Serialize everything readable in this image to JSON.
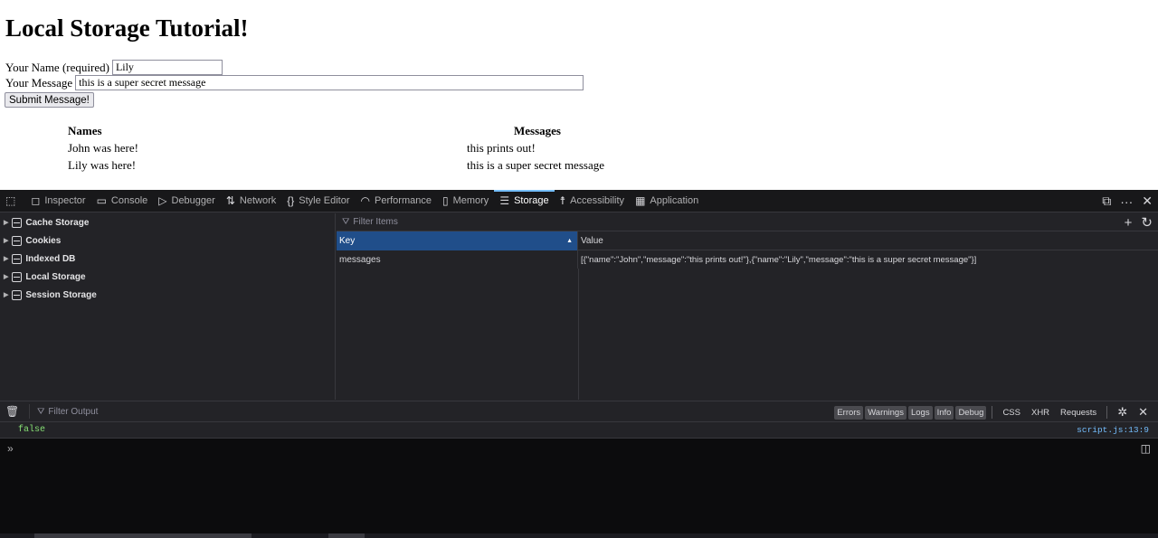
{
  "page": {
    "title": "Local Storage Tutorial!",
    "name_label": "Your Name (required)",
    "name_value": "Lily",
    "message_label": "Your Message",
    "message_value": "this is a super secret message",
    "submit_label": "Submit Message!",
    "table": {
      "headers": [
        "Names",
        "Messages"
      ],
      "rows": [
        {
          "name": "John was here!",
          "message": "this prints out!"
        },
        {
          "name": "Lily was here!",
          "message": "this is a super secret message"
        }
      ]
    }
  },
  "devtools": {
    "tabs": [
      {
        "label": "Inspector",
        "icon": "inspector-icon"
      },
      {
        "label": "Console",
        "icon": "console-icon"
      },
      {
        "label": "Debugger",
        "icon": "debugger-icon"
      },
      {
        "label": "Network",
        "icon": "network-icon"
      },
      {
        "label": "Style Editor",
        "icon": "style-editor-icon"
      },
      {
        "label": "Performance",
        "icon": "performance-icon"
      },
      {
        "label": "Memory",
        "icon": "memory-icon"
      },
      {
        "label": "Storage",
        "icon": "storage-icon",
        "active": true
      },
      {
        "label": "Accessibility",
        "icon": "accessibility-icon"
      },
      {
        "label": "Application",
        "icon": "application-icon"
      }
    ],
    "storage_tree": [
      "Cache Storage",
      "Cookies",
      "Indexed DB",
      "Local Storage",
      "Session Storage"
    ],
    "filter_placeholder": "Filter Items",
    "columns": {
      "key": "Key",
      "value": "Value"
    },
    "entry": {
      "key": "messages",
      "value": "[{\"name\":\"John\",\"message\":\"this prints out!\"},{\"name\":\"Lily\",\"message\":\"this is a super secret message\"}]"
    },
    "console": {
      "filter_placeholder": "Filter Output",
      "levels": [
        "Errors",
        "Warnings",
        "Logs",
        "Info",
        "Debug"
      ],
      "extra": [
        "CSS",
        "XHR",
        "Requests"
      ],
      "log_value": "false",
      "log_source": "script.js:13:9",
      "prompt": "»"
    },
    "accent_color": "#75bfff",
    "selected_header_color": "#204e8a"
  }
}
